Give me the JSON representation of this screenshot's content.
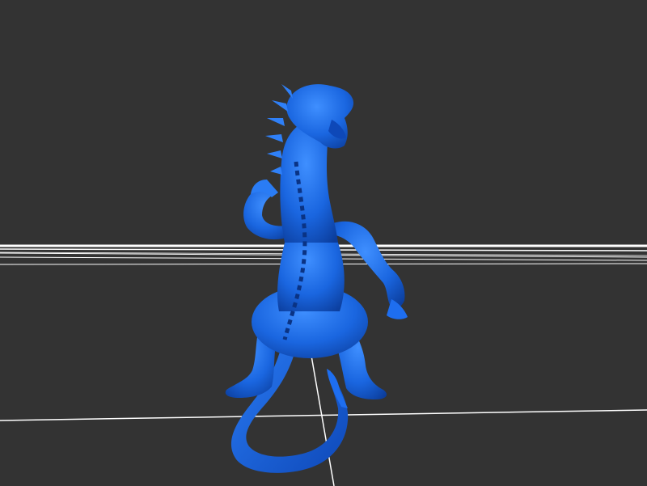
{
  "viewer": {
    "background_color": "#333333",
    "grid_color": "#ffffff",
    "model_color": "#1a66e0",
    "model_highlight": "#3a8cff",
    "model_shadow": "#0b3c9a",
    "subject": "dragon-model"
  }
}
